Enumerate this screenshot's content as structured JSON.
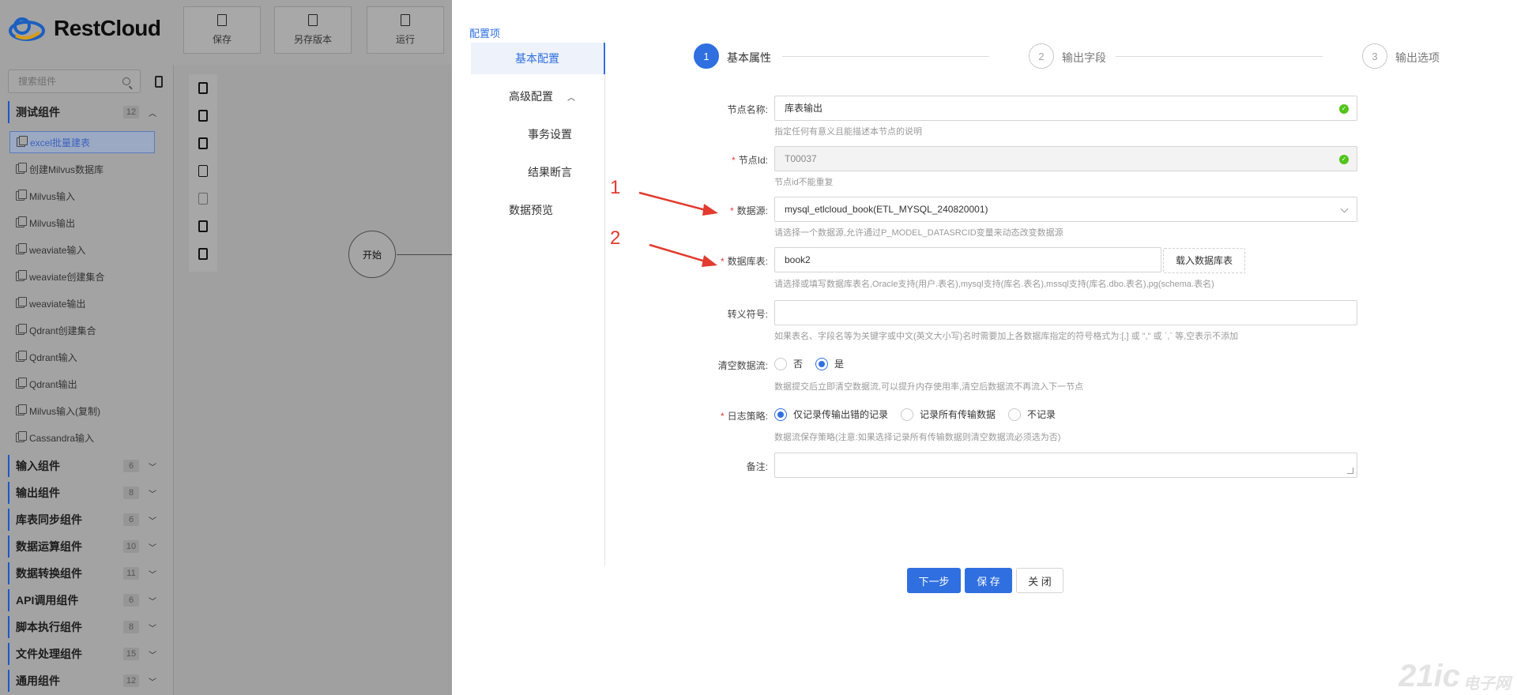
{
  "app": {
    "name": "RestCloud"
  },
  "toolbar": {
    "save": "保存",
    "save_version": "另存版本",
    "run": "运行"
  },
  "sidebar": {
    "search_placeholder": "搜索组件",
    "categories": [
      {
        "label": "测试组件",
        "count": "12",
        "expanded": true
      },
      {
        "label": "输入组件",
        "count": "6"
      },
      {
        "label": "输出组件",
        "count": "8"
      },
      {
        "label": "库表同步组件",
        "count": "6"
      },
      {
        "label": "数据运算组件",
        "count": "10"
      },
      {
        "label": "数据转换组件",
        "count": "11"
      },
      {
        "label": "API调用组件",
        "count": "6"
      },
      {
        "label": "脚本执行组件",
        "count": "8"
      },
      {
        "label": "文件处理组件",
        "count": "15"
      },
      {
        "label": "通用组件",
        "count": "12"
      }
    ],
    "items": [
      "excel批量建表",
      "创建Milvus数据库",
      "Milvus输入",
      "Milvus输出",
      "weaviate输入",
      "weaviate创建集合",
      "weaviate输出",
      "Qdrant创建集合",
      "Qdrant输入",
      "Qdrant输出",
      "Milvus输入(复制)",
      "Cassandra输入"
    ]
  },
  "canvas": {
    "start_node": "开始"
  },
  "panel": {
    "title": "配置项",
    "menu": {
      "basic": "基本配置",
      "advanced": "高级配置",
      "transaction": "事务设置",
      "assertion": "结果断言",
      "preview": "数据预览"
    }
  },
  "steps": [
    {
      "num": "1",
      "label": "基本属性"
    },
    {
      "num": "2",
      "label": "输出字段"
    },
    {
      "num": "3",
      "label": "输出选项"
    }
  ],
  "form": {
    "node_name": {
      "label": "节点名称:",
      "value": "库表输出",
      "help": "指定任何有意义且能描述本节点的说明"
    },
    "node_id": {
      "label": "节点Id:",
      "value": "T00037",
      "help": "节点id不能重复"
    },
    "datasource": {
      "label": "数据源:",
      "value": "mysql_etlcloud_book(ETL_MYSQL_240820001)",
      "help": "请选择一个数据源,允许通过P_MODEL_DATASRCID变量来动态改变数据源"
    },
    "table": {
      "label": "数据库表:",
      "value": "book2",
      "button": "载入数据库表",
      "help": "请选择或填写数据库表名,Oracle支持(用户.表名),mysql支持(库名.表名),mssql支持(库名.dbo.表名),pg(schema.表名)"
    },
    "escape": {
      "label": "转义符号:",
      "value": "",
      "help": "如果表名、字段名等为关键字或中文(英文大小写)名时需要加上各数据库指定的符号格式为:[,] 或 \",\" 或 `,` 等,空表示不添加"
    },
    "clear_stream": {
      "label": "清空数据流:",
      "options": [
        "否",
        "是"
      ],
      "selected": "是",
      "help": "数据提交后立即清空数据流,可以提升内存使用率,清空后数据流不再流入下一节点"
    },
    "log_policy": {
      "label": "日志策略:",
      "options": [
        "仅记录传输出错的记录",
        "记录所有传输数据",
        "不记录"
      ],
      "selected": "仅记录传输出错的记录",
      "help": "数据流保存策略(注意:如果选择记录所有传输数据则清空数据流必须选为否)"
    },
    "remark": {
      "label": "备注:",
      "value": ""
    }
  },
  "buttons": {
    "next": "下一步",
    "save": "保 存",
    "close": "关 闭"
  },
  "annotations": [
    "1",
    "2"
  ],
  "watermark": {
    "main": "21ic",
    "sub": "电子网"
  },
  "colors": {
    "primary": "#2f6fe0",
    "required": "#e63c3c",
    "annotation": "#e23b2f",
    "success": "#52c41a"
  }
}
